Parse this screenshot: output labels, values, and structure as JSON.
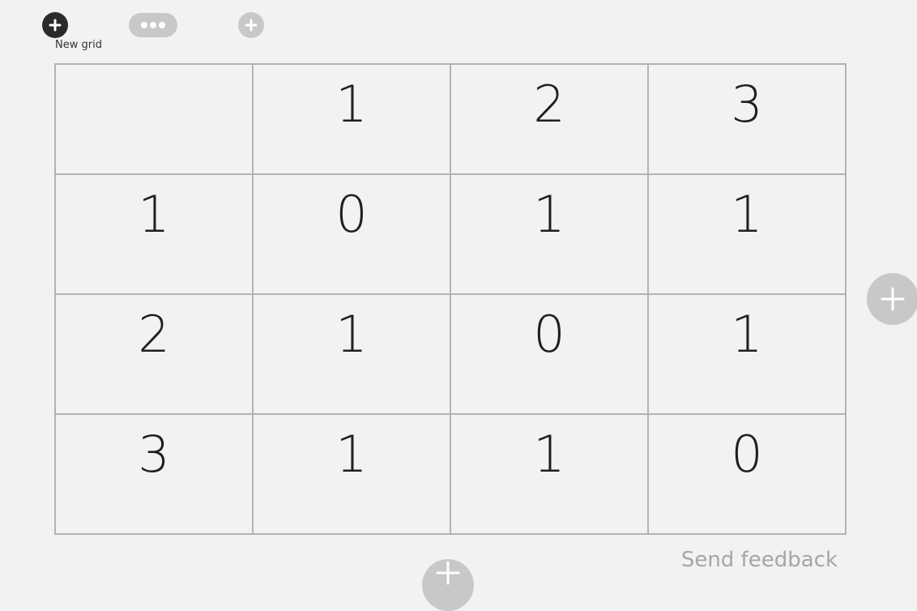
{
  "toolbar": {
    "new_grid_label": "New grid"
  },
  "grid": {
    "header": [
      "",
      "1",
      "2",
      "3"
    ],
    "rows": [
      [
        "1",
        "0",
        "1",
        "1"
      ],
      [
        "2",
        "1",
        "0",
        "1"
      ],
      [
        "3",
        "1",
        "1",
        "0"
      ]
    ]
  },
  "footer": {
    "feedback_label": "Send feedback"
  },
  "icons": {
    "new_grid": "plus-icon",
    "more": "more-dots-icon",
    "add": "plus-icon",
    "add_column": "plus-icon",
    "add_row": "plus-icon"
  },
  "colors": {
    "background": "#f2f2f2",
    "primary_button": "#2b2b2b",
    "secondary_button": "#c8c8c8",
    "grid_border": "#b3b3b3",
    "feedback_text": "#a6a6a6"
  }
}
